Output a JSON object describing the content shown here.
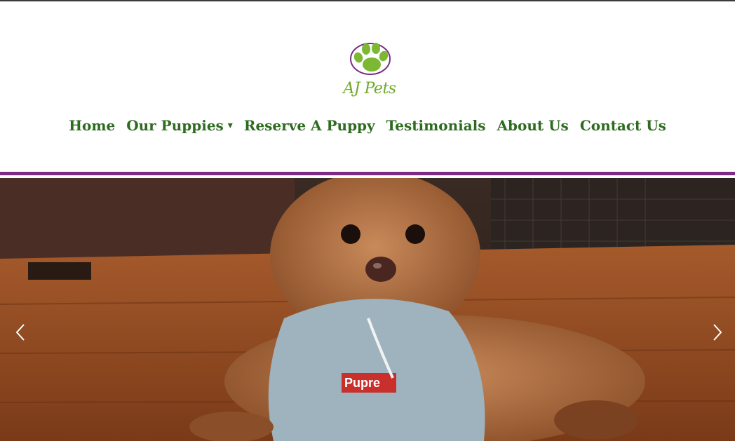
{
  "brand": {
    "name": "AJ Pets",
    "colors": {
      "paw_green": "#7cb832",
      "paw_outline": "#7b2d83",
      "nav_text": "#2d6b1f",
      "divider": "#7b2d83"
    }
  },
  "nav": {
    "items": [
      {
        "label": "Home"
      },
      {
        "label": "Our Puppies",
        "caret": "▾"
      },
      {
        "label": "Reserve A Puppy"
      },
      {
        "label": "Testimonials"
      },
      {
        "label": "About Us"
      },
      {
        "label": "Contact Us"
      }
    ]
  },
  "hero": {
    "image": "puppy-in-gray-hoodie",
    "hoodie_label": "Pupre",
    "icons": {
      "prev": "chevron-left-icon",
      "next": "chevron-right-icon"
    }
  }
}
